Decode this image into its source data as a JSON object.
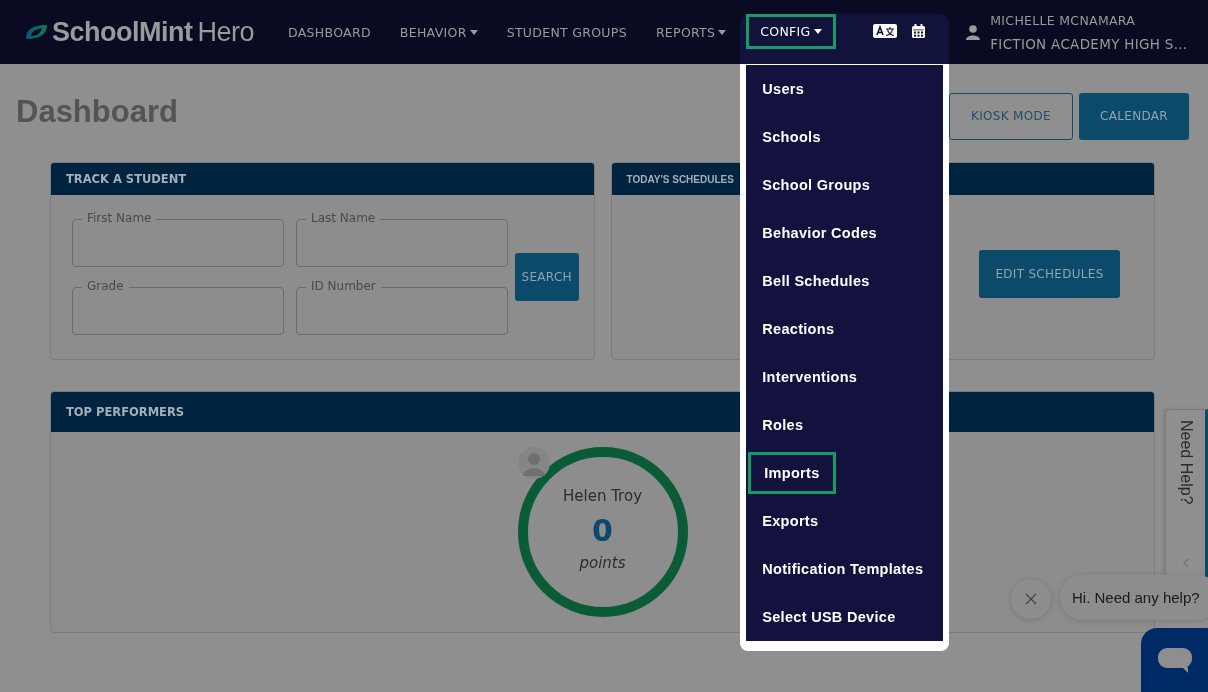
{
  "brand": {
    "name": "SchoolMint",
    "suffix": "Hero"
  },
  "nav": [
    {
      "label": "DASHBOARD",
      "dropdown": false,
      "highlighted": false
    },
    {
      "label": "BEHAVIOR",
      "dropdown": true,
      "highlighted": false
    },
    {
      "label": "STUDENT GROUPS",
      "dropdown": false,
      "highlighted": false
    },
    {
      "label": "REPORTS",
      "dropdown": true,
      "highlighted": false
    }
  ],
  "config": {
    "label": "CONFIG",
    "dropdown": true,
    "highlighted": true
  },
  "user": {
    "name": "MICHELLE MCNAMARA",
    "school": "FICTION ACADEMY HIGH S..."
  },
  "config_menu": [
    {
      "label": "Users",
      "highlighted": false
    },
    {
      "label": "Schools",
      "highlighted": false
    },
    {
      "label": "School Groups",
      "highlighted": false
    },
    {
      "label": "Behavior Codes",
      "highlighted": false
    },
    {
      "label": "Bell Schedules",
      "highlighted": false
    },
    {
      "label": "Reactions",
      "highlighted": false
    },
    {
      "label": "Interventions",
      "highlighted": false
    },
    {
      "label": "Roles",
      "highlighted": false
    },
    {
      "label": "Imports",
      "highlighted": true
    },
    {
      "label": "Exports",
      "highlighted": false
    },
    {
      "label": "Notification Templates",
      "highlighted": false
    },
    {
      "label": "Select USB Device",
      "highlighted": false
    }
  ],
  "page": {
    "title": "Dashboard",
    "buttons": [
      {
        "label": "KIOSK MODE",
        "kind": "outline"
      },
      {
        "label": "CALENDAR",
        "kind": "filled"
      }
    ]
  },
  "track_student": {
    "title": "TRACK A STUDENT",
    "fields": [
      {
        "label": "First Name"
      },
      {
        "label": "Last Name"
      },
      {
        "label": "Grade"
      },
      {
        "label": "ID Number"
      }
    ],
    "button": "SEARCH"
  },
  "schedules": {
    "title": "TODAY'S SCHEDULES",
    "button": "EDIT SCHEDULES"
  },
  "top_performers": {
    "title": "TOP PERFORMERS",
    "performers": [
      {
        "name": "Helen Troy",
        "points": "0",
        "unit": "points"
      }
    ]
  },
  "help_tab": {
    "label": "Need Help?"
  },
  "chat": {
    "message": "Hi. Need any help?"
  }
}
